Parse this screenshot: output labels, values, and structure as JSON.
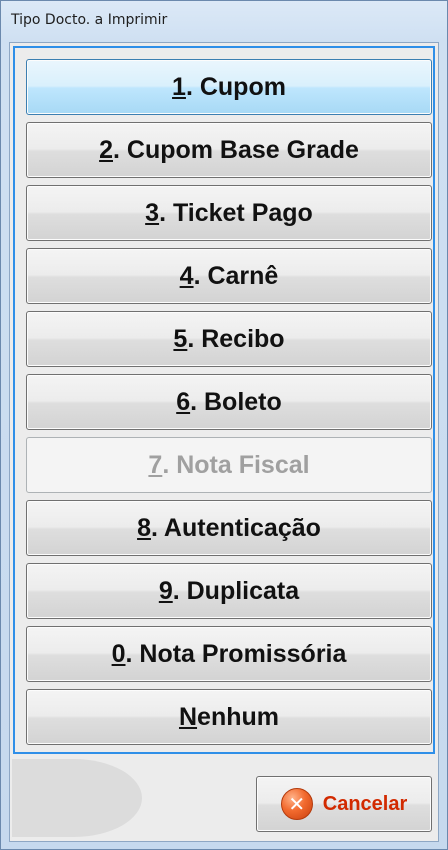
{
  "window": {
    "title": "Tipo Docto. a Imprimir"
  },
  "options": [
    {
      "key": "1",
      "rest": ". Cupom",
      "state": "focused"
    },
    {
      "key": "2",
      "rest": ". Cupom Base Grade",
      "state": "normal"
    },
    {
      "key": "3",
      "rest": ". Ticket Pago",
      "state": "normal"
    },
    {
      "key": "4",
      "rest": ". Carnê",
      "state": "normal"
    },
    {
      "key": "5",
      "rest": ". Recibo",
      "state": "normal"
    },
    {
      "key": "6",
      "rest": ". Boleto",
      "state": "normal"
    },
    {
      "key": "7",
      "rest": ". Nota Fiscal",
      "state": "disabled"
    },
    {
      "key": "8",
      "rest": ". Autenticação",
      "state": "normal"
    },
    {
      "key": "9",
      "rest": ". Duplicata",
      "state": "normal"
    },
    {
      "key": "0",
      "rest": ". Nota Promissória",
      "state": "normal"
    },
    {
      "key": "N",
      "rest": "enhum",
      "state": "normal"
    }
  ],
  "cancel": {
    "label": "Cancelar",
    "icon": "close-circle-icon"
  },
  "colors": {
    "focus_border": "#2f8fe8",
    "cancel_text": "#d22a00"
  }
}
